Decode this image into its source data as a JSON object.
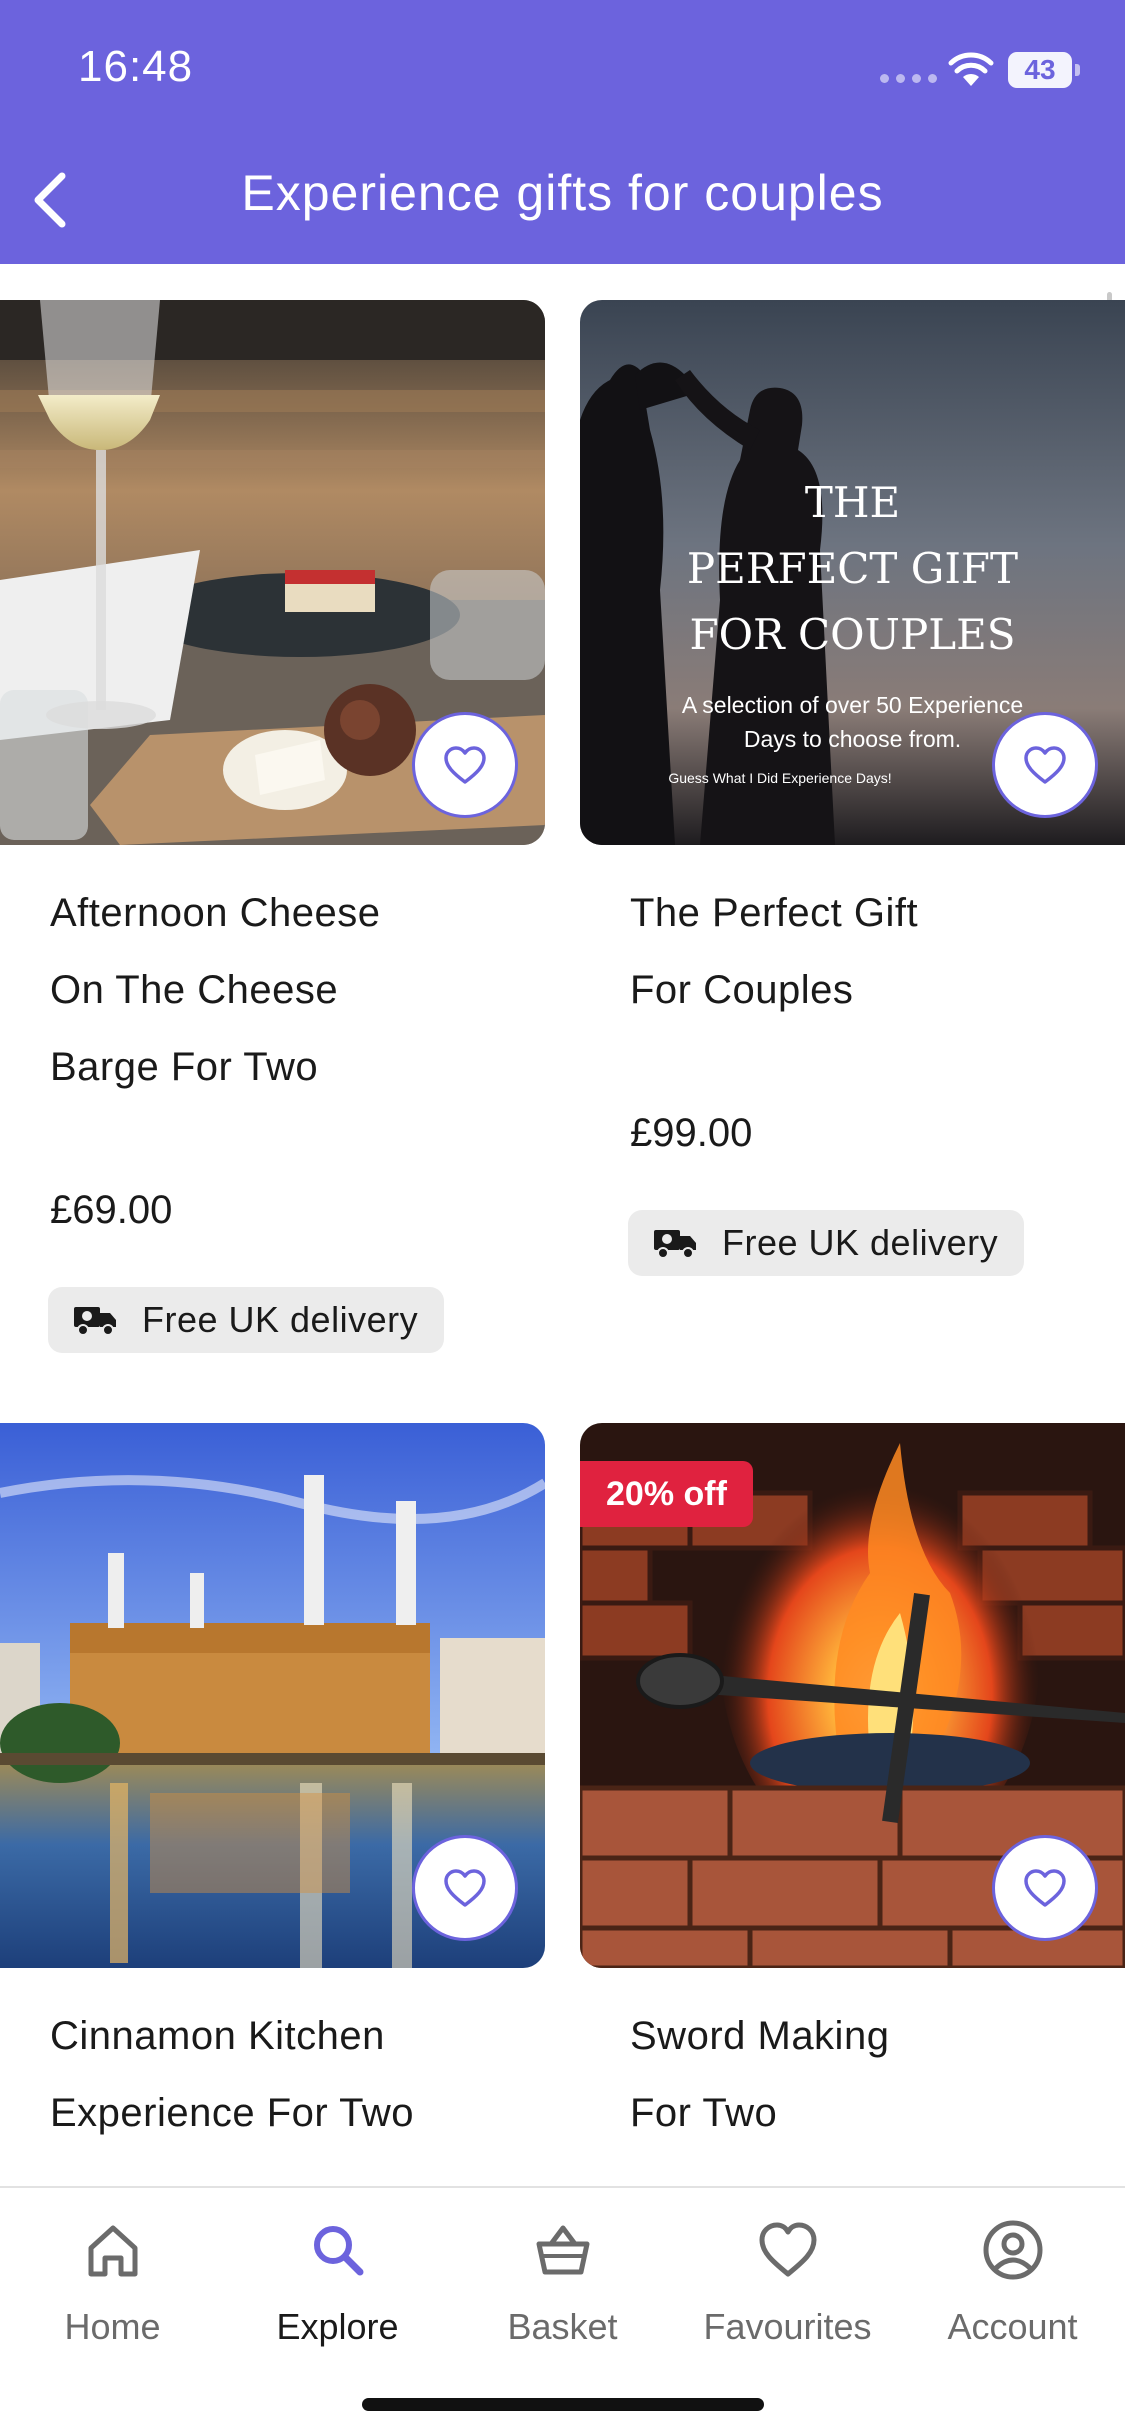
{
  "status_bar": {
    "time": "16:48",
    "battery": "43"
  },
  "header": {
    "title": "Experience gifts for couples"
  },
  "products": [
    {
      "title_lines": [
        "Afternoon Cheese",
        "On The Cheese",
        "Barge For Two"
      ],
      "price": "£69.00",
      "delivery": "Free UK delivery",
      "image": "cheese-and-wine-photo"
    },
    {
      "title_lines": [
        "The Perfect Gift",
        "For Couples"
      ],
      "price": "£99.00",
      "delivery": "Free UK delivery",
      "image": "dancing-couple-photo",
      "image_text": {
        "line1": "THE",
        "line2": "PERFECT GIFT",
        "line3": "FOR COUPLES",
        "sub1": "A selection of over 50 Experience",
        "sub2": "Days to choose from.",
        "brand": "Guess What I Did Experience Days!"
      }
    },
    {
      "title_lines": [
        "Cinnamon Kitchen",
        "Experience For Two"
      ],
      "image": "battersea-power-station-photo"
    },
    {
      "title_lines": [
        "Sword Making",
        "For Two"
      ],
      "badge": "20% off",
      "image": "forge-sword-photo"
    }
  ],
  "nav": {
    "items": [
      {
        "label": "Home",
        "icon": "home-icon"
      },
      {
        "label": "Explore",
        "icon": "search-icon"
      },
      {
        "label": "Basket",
        "icon": "basket-icon"
      },
      {
        "label": "Favourites",
        "icon": "heart-icon"
      },
      {
        "label": "Account",
        "icon": "account-icon"
      }
    ],
    "active": "Explore"
  },
  "colors": {
    "brand": "#6c63dd",
    "discount": "#e0223f",
    "pill": "#ebebeb",
    "text": "#1a1a1a"
  }
}
